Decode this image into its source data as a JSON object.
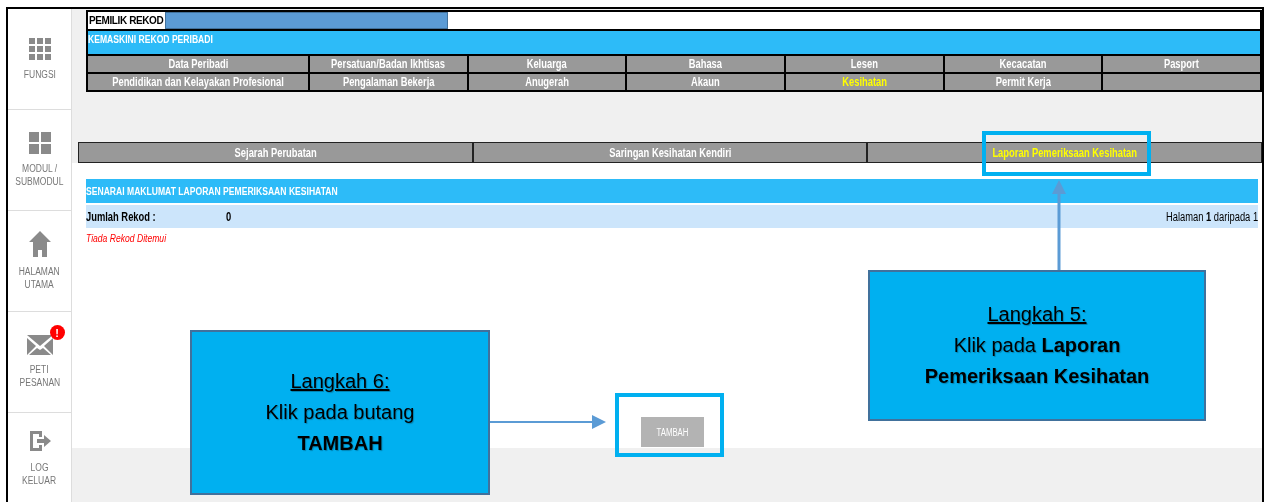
{
  "sidebar": {
    "items": [
      {
        "kind": "grid9",
        "label": [
          "FUNGSI"
        ]
      },
      {
        "kind": "grid4",
        "label": [
          "MODUL /",
          "SUBMODUL"
        ]
      },
      {
        "kind": "home",
        "label": [
          "HALAMAN",
          "UTAMA"
        ]
      },
      {
        "kind": "mail",
        "label": [
          "PETI",
          "PESANAN"
        ],
        "badge": "!"
      },
      {
        "kind": "logout",
        "label": [
          "LOG",
          "KELUAR"
        ]
      }
    ]
  },
  "record_owner": {
    "label": "PEMILIK REKOD"
  },
  "section_title": "KEMASKINI REKOD PERIBADI",
  "tabs": [
    [
      {
        "label": "Data Peribadi",
        "selected": false
      },
      {
        "label": "Persatuan/Badan Ikhtisas",
        "selected": false
      },
      {
        "label": "Keluarga",
        "selected": false
      },
      {
        "label": "Bahasa",
        "selected": false
      },
      {
        "label": "Lesen",
        "selected": false
      },
      {
        "label": "Kecacatan",
        "selected": false
      },
      {
        "label": "Pasport",
        "selected": false
      }
    ],
    [
      {
        "label": "Pendidikan dan Kelayakan Profesional",
        "selected": false
      },
      {
        "label": "Pengalaman Bekerja",
        "selected": false
      },
      {
        "label": "Anugerah",
        "selected": false
      },
      {
        "label": "Akaun",
        "selected": false
      },
      {
        "label": "Kesihatan",
        "selected": true
      },
      {
        "label": "Permit Kerja",
        "selected": false
      }
    ]
  ],
  "subtabs": [
    {
      "label": "Sejarah Perubatan",
      "selected": false
    },
    {
      "label": "Saringan Kesihatan Kendiri",
      "selected": false
    },
    {
      "label": "Laporan Pemeriksaan Kesihatan",
      "selected": true
    }
  ],
  "list": {
    "title": "SENARAI MAKLUMAT LAPORAN PEMERIKSAAN KESIHATAN",
    "count_label": "Jumlah Rekod :",
    "count": "0",
    "pager": "Halaman **1** daripada 1",
    "empty_message": "Tiada Rekod Ditemui"
  },
  "add_button": "TAMBAH",
  "callouts": [
    {
      "step": "Langkah 5:",
      "text": "Klik pada **Laporan Pemeriksaan Kesihatan**",
      "kind": "subtab"
    },
    {
      "step": "Langkah 6:",
      "text": "Klik pada butang **TAMBAH**",
      "kind": "button"
    }
  ]
}
